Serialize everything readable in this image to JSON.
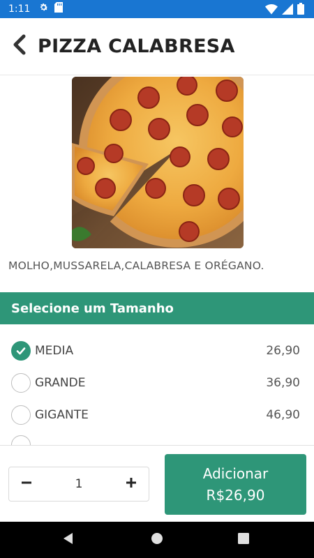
{
  "status_bar": {
    "time": "1:11",
    "left_icons": [
      "gear-icon",
      "sd-card-icon"
    ],
    "right_icons": [
      "wifi-icon",
      "signal-icon",
      "battery-icon"
    ],
    "color": "#1976d2"
  },
  "header": {
    "title": "PIZZA CALABRESA",
    "back_icon": "chevron-left-icon"
  },
  "product": {
    "image_subject": "pepperoni pizza",
    "description": "MOLHO,MUSSARELA,CALABRESA E ORÉGANO."
  },
  "size_section": {
    "title": "Selecione um Tamanho",
    "options": [
      {
        "label": "MEDIA",
        "price": "26,90",
        "selected": true
      },
      {
        "label": "GRANDE",
        "price": "36,90",
        "selected": false
      },
      {
        "label": "GIGANTE",
        "price": "46,90",
        "selected": false
      }
    ]
  },
  "footer": {
    "quantity": "1",
    "decrement_icon": "minus-icon",
    "increment_icon": "plus-icon",
    "add_button": {
      "label": "Adicionar",
      "price": "R$26,90"
    }
  },
  "nav_bar": {
    "buttons": [
      "back-triangle-icon",
      "home-circle-icon",
      "recents-square-icon"
    ]
  },
  "colors": {
    "accent": "#2e9678",
    "status_bar": "#1976d2",
    "text_dark": "#222222"
  }
}
